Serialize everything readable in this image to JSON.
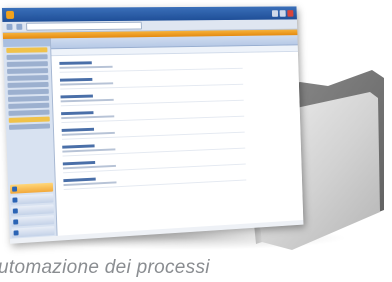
{
  "caption": "utomazione dei processi",
  "colors": {
    "titlebar": "#2a5ca8",
    "accent_orange": "#f0a12a",
    "folder_gray": "#c8c8c8",
    "caption_gray": "#8a8d91"
  },
  "icons": {
    "folder": "folder-icon",
    "app": "app-icon"
  }
}
